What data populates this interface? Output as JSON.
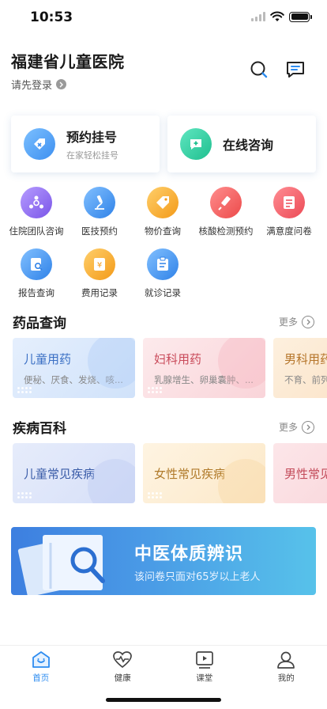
{
  "status_bar": {
    "time": "10:53"
  },
  "header": {
    "title": "福建省儿童医院",
    "login_prompt": "请先登录"
  },
  "primary_cards": [
    {
      "title": "预约挂号",
      "subtitle": "在家轻松挂号",
      "color": "#5aa8f5"
    },
    {
      "title": "在线咨询",
      "subtitle": "",
      "color": "#2fd3a5"
    }
  ],
  "grid": [
    {
      "label": "住院团队咨询",
      "icon": "team-icon",
      "color": "#8e6cf0"
    },
    {
      "label": "医技预约",
      "icon": "microscope-icon",
      "color": "#3e95ef"
    },
    {
      "label": "物价查询",
      "icon": "price-tag-icon",
      "color": "#f5a623"
    },
    {
      "label": "核酸检测预约",
      "icon": "syringe-icon",
      "color": "#f45a5a"
    },
    {
      "label": "满意度问卷",
      "icon": "survey-icon",
      "color": "#f45a64"
    },
    {
      "label": "报告查询",
      "icon": "report-icon",
      "color": "#3e95ef"
    },
    {
      "label": "费用记录",
      "icon": "fee-icon",
      "color": "#f5a623"
    },
    {
      "label": "就诊记录",
      "icon": "record-icon",
      "color": "#3e95ef"
    }
  ],
  "drugs": {
    "title": "药品查询",
    "more": "更多",
    "cards": [
      {
        "title": "儿童用药",
        "subtitle": "便秘、厌食、发烧、咳...",
        "bg": "#dce9fb",
        "color": "#3a6fc4"
      },
      {
        "title": "妇科用药",
        "subtitle": "乳腺增生、卵巢囊肿、...",
        "bg": "#fce3e6",
        "color": "#c94a5a"
      },
      {
        "title": "男科用药",
        "subtitle": "不育、前列",
        "bg": "#fdebd6",
        "color": "#b5752a"
      }
    ]
  },
  "diseases": {
    "title": "疾病百科",
    "more": "更多",
    "cards": [
      {
        "title": "儿童常见疾病",
        "bg": "#dfe6fa",
        "color": "#3a5ca8"
      },
      {
        "title": "女性常见疾病",
        "bg": "#fdf0d9",
        "color": "#b07a2a"
      },
      {
        "title": "男性常见",
        "bg": "#fbe0e3",
        "color": "#c34b5a"
      }
    ]
  },
  "banner": {
    "title": "中医体质辨识",
    "subtitle": "该问卷只面对65岁以上老人"
  },
  "tabbar": [
    {
      "label": "首页",
      "active": true
    },
    {
      "label": "健康",
      "active": false
    },
    {
      "label": "课堂",
      "active": false
    },
    {
      "label": "我的",
      "active": false
    }
  ]
}
